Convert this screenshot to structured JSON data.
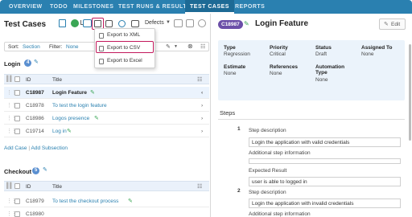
{
  "nav": {
    "items": [
      "OVERVIEW",
      "TODO",
      "MILESTONES",
      "TEST RUNS & RESULTS",
      "TEST CASES",
      "REPORTS"
    ],
    "active_index": 4
  },
  "left": {
    "title": "Test Cases",
    "toolbar": {
      "defects_label": "Defects"
    },
    "filter": {
      "sort_label": "Sort:",
      "sort_value": "Section",
      "filter_label": "Filter:",
      "filter_value": "None"
    },
    "export_menu": {
      "items": [
        "Export to XML",
        "Export to CSV",
        "Export to Excel"
      ],
      "highlighted_index": 1
    },
    "sections": [
      {
        "name": "Login",
        "count": "4",
        "header": {
          "id": "ID",
          "title": "Title"
        },
        "rows": [
          {
            "id": "C18987",
            "title": "Login Feature",
            "selected": true
          },
          {
            "id": "C18978",
            "title": "To test the login feature",
            "selected": false
          },
          {
            "id": "C18986",
            "title": "Logos presence",
            "selected": false
          },
          {
            "id": "C19714",
            "title": "Log in",
            "selected": false
          }
        ],
        "actions": {
          "add_case": "Add Case",
          "separator": "|",
          "add_subsection": "Add Subsection"
        }
      },
      {
        "name": "Checkout",
        "count": "5",
        "header": {
          "id": "ID",
          "title": "Title"
        },
        "rows": [
          {
            "id": "C18979",
            "title": "To test the checkout process",
            "selected": false
          },
          {
            "id": "C18980",
            "title": "",
            "selected": false
          }
        ]
      }
    ]
  },
  "right": {
    "case_id": "C18987",
    "title": "Login Feature",
    "edit_label": "Edit",
    "fields": [
      {
        "key": "Type",
        "value": "Regression"
      },
      {
        "key": "Priority",
        "value": "Critical"
      },
      {
        "key": "Status",
        "value": "Draft"
      },
      {
        "key": "Assigned To",
        "value": "None"
      },
      {
        "key": "Estimate",
        "value": "None"
      },
      {
        "key": "References",
        "value": "None"
      },
      {
        "key": "Automation Type",
        "value": "None"
      }
    ],
    "steps_label": "Steps",
    "steps": [
      {
        "number": "1",
        "description_label": "Step description",
        "description": "Login the application with valid credentials",
        "additional_label": "Additional step information",
        "additional": "",
        "expected_label": "Expected Result",
        "expected": "user is able to logged in"
      },
      {
        "number": "2",
        "description_label": "Step description",
        "description": "Login the application with invalid credentials",
        "additional_label": "Additional step information"
      }
    ]
  },
  "colors": {
    "nav_bg": "#2a80b0",
    "highlight": "#c2185b",
    "badge_purple": "#6b4fa8",
    "link_blue": "#2a80b0",
    "success_green": "#3aa655"
  }
}
